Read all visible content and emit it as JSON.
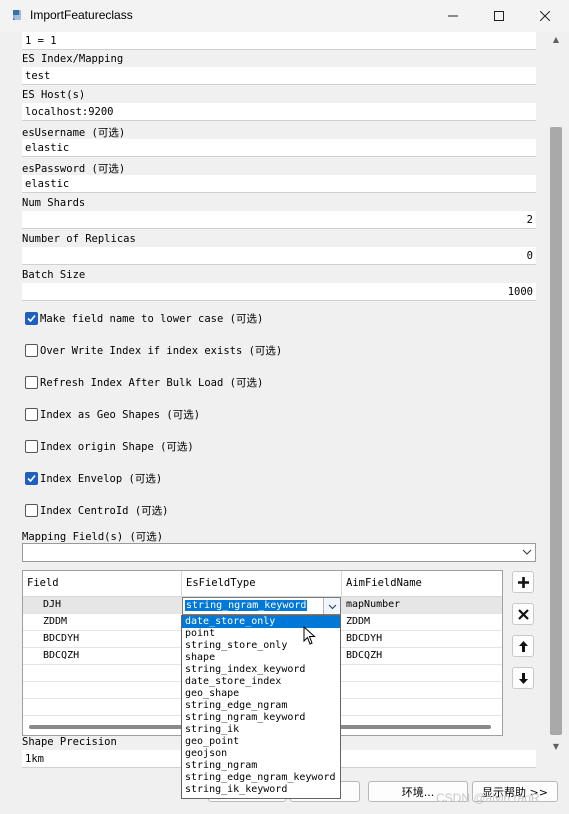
{
  "window": {
    "title": "ImportFeatureclass",
    "minimize_glyph": "—",
    "maximize_glyph": "☐",
    "close_glyph": "✕"
  },
  "form": {
    "where_clause_value": "1 = 1",
    "es_index_label": "ES Index/Mapping",
    "es_index_value": "test",
    "es_host_label": "ES Host(s)",
    "es_host_value": "localhost:9200",
    "username_label": "esUsername (可选)",
    "username_value": "elastic",
    "password_label": "esPassword (可选)",
    "password_value": "elastic",
    "shards_label": "Num Shards",
    "shards_value": "2",
    "replicas_label": "Number of Replicas",
    "replicas_value": "0",
    "batch_label": "Batch Size",
    "batch_value": "1000",
    "checkboxes": [
      {
        "label": "Make field name to lower case (可选)",
        "checked": true
      },
      {
        "label": "Over Write Index if index exists (可选)",
        "checked": false
      },
      {
        "label": "Refresh Index After Bulk Load (可选)",
        "checked": false
      },
      {
        "label": "Index as Geo Shapes (可选)",
        "checked": false
      },
      {
        "label": "Index origin Shape (可选)",
        "checked": false
      },
      {
        "label": "Index Envelop (可选)",
        "checked": true
      },
      {
        "label": "Index CentroId (可选)",
        "checked": false
      }
    ],
    "mapping_label": "Mapping Field(s) (可选)",
    "mapping_value": "",
    "precision_label": "Shape Precision",
    "precision_value": "1km"
  },
  "grid": {
    "columns": [
      "Field",
      "EsFieldType",
      "AimFieldName"
    ],
    "rows": [
      {
        "field": "DJH",
        "type": "string_ngram_keyword",
        "aim": "mapNumber"
      },
      {
        "field": "ZDDM",
        "type": "",
        "aim": "ZDDM"
      },
      {
        "field": "BDCDYH",
        "type": "",
        "aim": "BDCDYH"
      },
      {
        "field": "BDCQZH",
        "type": "",
        "aim": "BDCQZH"
      }
    ],
    "editing_value": "string_ngram_keyword"
  },
  "dropdown_options": [
    "date_store_only",
    "point",
    "string_store_only",
    "shape",
    "string_index_keyword",
    "date_store_index",
    "geo_shape",
    "string_edge_ngram",
    "string_ngram_keyword",
    "string_ik",
    "geo_point",
    "geojson",
    "string_ngram",
    "string_edge_ngram_keyword",
    "string_ik_keyword"
  ],
  "buttons": {
    "env_label": "环境...",
    "help_label": "显示帮助 >>"
  },
  "watermark": "CSDN @alvin raoR",
  "colors": {
    "accent": "#0078d7",
    "checkbox_checked": "#1f5fbf"
  }
}
